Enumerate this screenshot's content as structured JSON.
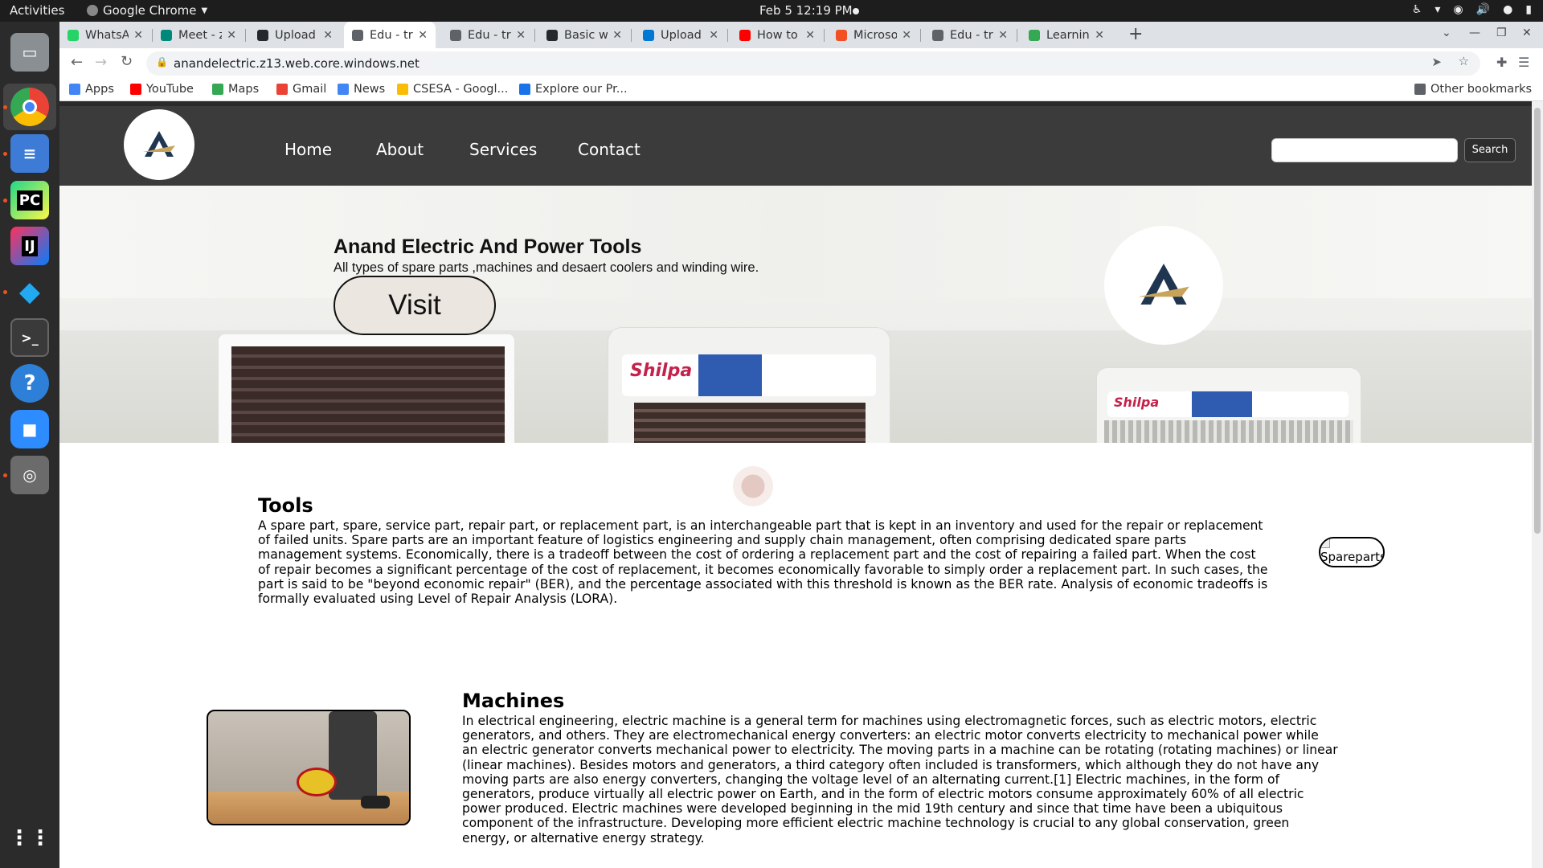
{
  "system": {
    "activities": "Activities",
    "app_name": "Google Chrome",
    "clock": "Feb 5  12:19 PM"
  },
  "browser": {
    "tabs": [
      {
        "title": "WhatsApp",
        "color": "#25d366"
      },
      {
        "title": "Meet - zk",
        "color": "#00897b"
      },
      {
        "title": "Upload files",
        "color": "#24292e"
      },
      {
        "title": "Edu - transfe",
        "color": "#5f6368",
        "active": true
      },
      {
        "title": "Edu - transfe",
        "color": "#5f6368"
      },
      {
        "title": "Basic writin",
        "color": "#24292e"
      },
      {
        "title": "Upload blob",
        "color": "#0078d4"
      },
      {
        "title": "How to host",
        "color": "#ff0000"
      },
      {
        "title": "Microsoft A",
        "color": "#f25022"
      },
      {
        "title": "Edu - transfe",
        "color": "#5f6368"
      },
      {
        "title": "Learning | F",
        "color": "#34a853"
      }
    ],
    "url": "anandelectric.z13.web.core.windows.net",
    "bookmarks": [
      {
        "label": "Apps",
        "color": "#4285f4"
      },
      {
        "label": "YouTube",
        "color": "#ff0000"
      },
      {
        "label": "Maps",
        "color": "#34a853"
      },
      {
        "label": "Gmail",
        "color": "#ea4335"
      },
      {
        "label": "News",
        "color": "#4285f4"
      },
      {
        "label": "CSESA - Googl...",
        "color": "#fbbc04"
      },
      {
        "label": "Explore our Pr...",
        "color": "#1a73e8"
      }
    ],
    "other_bookmarks": "Other bookmarks"
  },
  "site": {
    "nav": {
      "home": "Home",
      "about": "About",
      "services": "Services",
      "contact": "Contact",
      "search_button": "Search"
    },
    "hero": {
      "title": "Anand Electric And Power Tools",
      "subtitle": "All types of spare parts ,machines and desaert coolers and winding wire.",
      "visit_button": "Visit",
      "brand_left": "Shilpa",
      "brand_right": "Shilpa"
    },
    "tools": {
      "title": "Tools",
      "body": "A spare part, spare, service part, repair part, or replacement part, is an interchangeable part that is kept in an inventory and used for the repair or replacement of failed units. Spare parts are an important feature of logistics engineering and supply chain management, often comprising dedicated spare parts management systems. Economically, there is a tradeoff between the cost of ordering a replacement part and the cost of repairing a failed part. When the cost of repair becomes a significant percentage of the cost of replacement, it becomes economically favorable to simply order a replacement part. In such cases, the part is said to be \"beyond economic repair\" (BER), and the percentage associated with this threshold is known as the BER rate. Analysis of economic tradeoffs is formally evaluated using Level of Repair Analysis (LORA).",
      "image_alt": "Spareparts"
    },
    "machines": {
      "title": "Machines",
      "body": "In electrical engineering, electric machine is a general term for machines using electromagnetic forces, such as electric motors, electric generators, and others. They are electromechanical energy converters: an electric motor converts electricity to mechanical power while an electric generator converts mechanical power to electricity. The moving parts in a machine can be rotating (rotating machines) or linear (linear machines). Besides motors and generators, a third category often included is transformers, which although they do not have any moving parts are also energy converters, changing the voltage level of an alternating current.[1] Electric machines, in the form of generators, produce virtually all electric power on Earth, and in the form of electric motors consume approximately 60% of all electric power produced. Electric machines were developed beginning in the mid 19th century and since that time have been a ubiquitous component of the infrastructure. Developing more efficient electric machine technology is crucial to any global conservation, green energy, or alternative energy strategy."
    }
  },
  "colors": {
    "navbar": "#3b3b3b",
    "logo_navy": "#1f3550",
    "logo_gold": "#c8a45a"
  }
}
